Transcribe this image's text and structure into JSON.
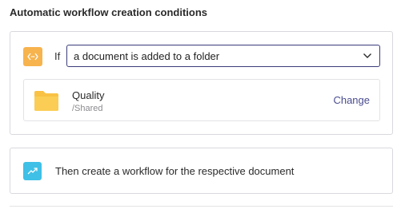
{
  "section": {
    "title": "Automatic workflow creation conditions"
  },
  "trigger": {
    "icon": "code-arrows-icon",
    "icon_color": "#f7b34d",
    "if_label": "If",
    "condition_value": "a document is added to a folder"
  },
  "folder": {
    "icon": "folder-icon",
    "icon_color": "#f9c245",
    "name": "Quality",
    "path": "/Shared",
    "change_label": "Change"
  },
  "action": {
    "icon": "trend-arrow-icon",
    "icon_color": "#3fc0e6",
    "text": "Then create a workflow for the respective document"
  },
  "colors": {
    "accent": "#3b3d7a",
    "link": "#4a4c8f",
    "border": "#d9d9de"
  }
}
